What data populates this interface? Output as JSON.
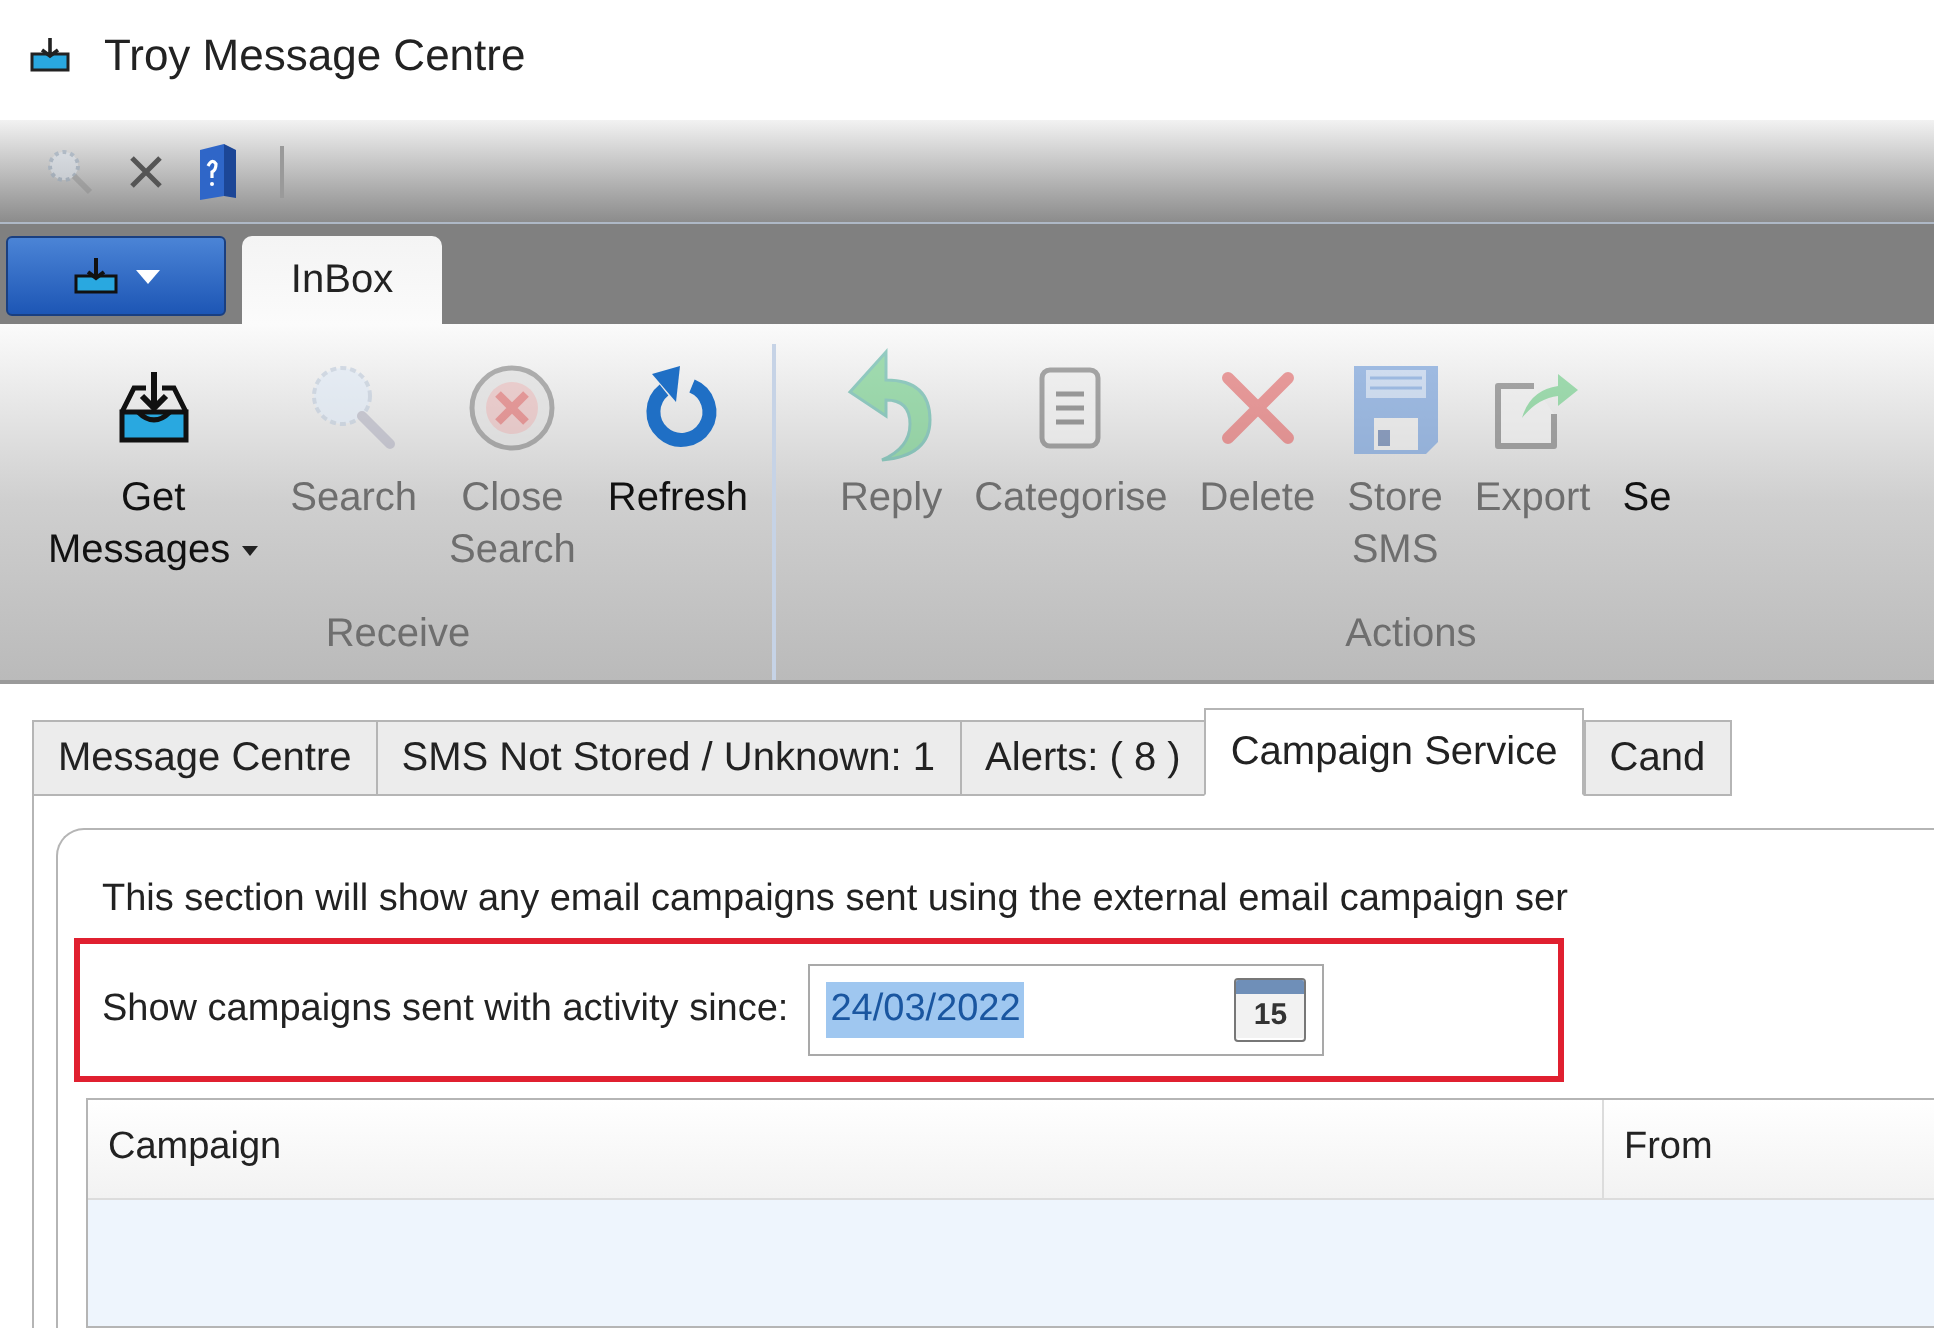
{
  "window": {
    "title": "Troy Message Centre"
  },
  "quick_access": [
    {
      "disabled": true
    },
    {
      "disabled": false
    },
    {
      "disabled": false
    }
  ],
  "ribbon": {
    "tabs": [
      {
        "label": "InBox",
        "selected": true
      }
    ],
    "groups": [
      {
        "label": "Receive",
        "buttons": [
          {
            "lines": [
              "Get",
              "Messages"
            ],
            "dropdown": true,
            "disabled": false
          },
          {
            "lines": [
              "Search"
            ],
            "disabled": true
          },
          {
            "lines": [
              "Close",
              "Search"
            ],
            "disabled": true
          },
          {
            "lines": [
              "Refresh"
            ],
            "disabled": false
          }
        ]
      },
      {
        "label": "Actions",
        "buttons": [
          {
            "lines": [
              "Reply"
            ],
            "disabled": true
          },
          {
            "lines": [
              "Categorise"
            ],
            "disabled": true
          },
          {
            "lines": [
              "Delete"
            ],
            "disabled": true
          },
          {
            "lines": [
              "Store",
              "SMS"
            ],
            "disabled": true
          },
          {
            "lines": [
              "Export"
            ],
            "disabled": true
          },
          {
            "lines": [
              "Se"
            ],
            "disabled": false
          }
        ]
      }
    ]
  },
  "tabs": [
    {
      "label": "Message Centre",
      "selected": false
    },
    {
      "label": "SMS Not Stored / Unknown: 1",
      "selected": false
    },
    {
      "label": "Alerts: ( 8 )",
      "selected": false
    },
    {
      "label": "Campaign Service",
      "selected": true
    },
    {
      "label": "Cand",
      "selected": false
    }
  ],
  "campaign": {
    "description": "This section will show any email campaigns sent using the external email campaign ser",
    "since_label": "Show campaigns sent with activity since:",
    "date": {
      "value": "24/03/2022",
      "text_selected": true,
      "calendar_day": "15"
    },
    "table": {
      "columns": [
        "Campaign",
        "From"
      ]
    }
  }
}
